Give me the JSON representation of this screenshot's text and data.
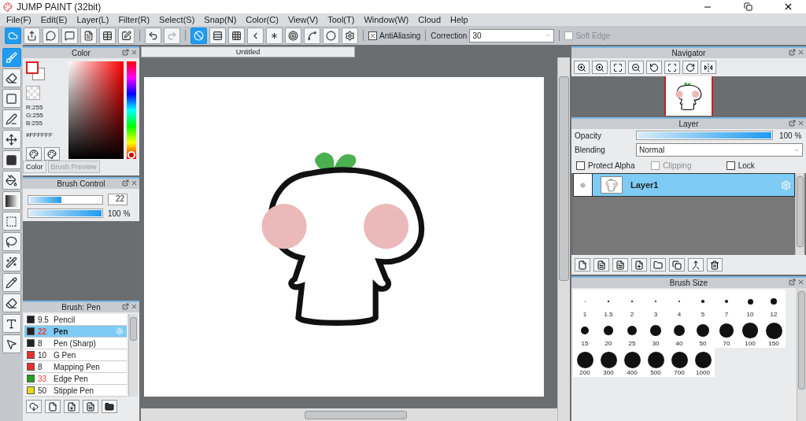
{
  "window": {
    "title": "JUMP PAINT (32bit)"
  },
  "menu": [
    "File(F)",
    "Edit(E)",
    "Layer(L)",
    "Filter(R)",
    "Select(S)",
    "Snap(N)",
    "Color(C)",
    "View(V)",
    "Tool(T)",
    "Window(W)",
    "Cloud",
    "Help"
  ],
  "toolbar": {
    "file_tools": [
      {
        "kind": "cloud",
        "selected": true
      },
      {
        "kind": "share",
        "selected": false
      },
      {
        "kind": "bubble",
        "selected": false
      },
      {
        "kind": "comment",
        "selected": false
      },
      {
        "kind": "page",
        "selected": false
      },
      {
        "kind": "table",
        "selected": false
      },
      {
        "kind": "edit",
        "selected": false
      }
    ],
    "history": [
      {
        "kind": "undo",
        "disabled": false
      },
      {
        "kind": "redo",
        "disabled": true
      }
    ],
    "snap_tools": [
      {
        "kind": "none",
        "selected": true
      },
      {
        "kind": "parallel",
        "selected": false
      },
      {
        "kind": "grid",
        "selected": false
      },
      {
        "kind": "perspective",
        "selected": false
      },
      {
        "kind": "radial",
        "selected": false
      },
      {
        "kind": "concentric",
        "selected": false
      },
      {
        "kind": "curve",
        "selected": false
      },
      {
        "kind": "ellipse",
        "selected": false
      },
      {
        "kind": "settings",
        "selected": false
      }
    ],
    "antialiasing": {
      "label": "AntiAliasing",
      "checked": true
    },
    "correction": {
      "label": "Correction",
      "value": "30"
    },
    "soft_edge": {
      "label": "Soft Edge",
      "checked": false,
      "disabled": true
    }
  },
  "tools": [
    {
      "kind": "brush",
      "selected": true
    },
    {
      "kind": "eraser",
      "selected": false
    },
    {
      "kind": "square",
      "selected": false
    },
    {
      "kind": "vector",
      "selected": false
    },
    {
      "kind": "move",
      "selected": false
    },
    {
      "kind": "fill",
      "selected": false
    },
    {
      "kind": "bucket",
      "selected": false
    },
    {
      "kind": "gradient",
      "selected": false
    },
    {
      "kind": "rect_select",
      "selected": false
    },
    {
      "kind": "lasso",
      "selected": false
    },
    {
      "kind": "wand",
      "selected": false
    },
    {
      "kind": "select_pen",
      "selected": false
    },
    {
      "kind": "select_eraser",
      "selected": false
    },
    {
      "kind": "text",
      "selected": false
    },
    {
      "kind": "pointer",
      "selected": false
    }
  ],
  "color_panel": {
    "title": "Color",
    "r": "R:255",
    "g": "G:255",
    "b": "B:255",
    "hex": "#FFFFFF",
    "tabs": [
      {
        "label": "Color",
        "selected": true
      },
      {
        "label": "Brush Preview",
        "selected": false
      }
    ]
  },
  "brush_control": {
    "title": "Brush Control",
    "size": {
      "level": 0.45,
      "value": "22"
    },
    "opacity": {
      "level": 1,
      "reading": "100 %"
    }
  },
  "brush_list": {
    "title": "Brush: Pen",
    "items": [
      {
        "color": "#222222",
        "size": "9.5",
        "size_changed": false,
        "name": "Pencil",
        "selected": false
      },
      {
        "color": "#222222",
        "size": "22",
        "size_changed": true,
        "name": "Pen",
        "selected": true
      },
      {
        "color": "#222222",
        "size": "8",
        "size_changed": false,
        "name": "Pen (Sharp)",
        "selected": false
      },
      {
        "color": "#e8302c",
        "size": "10",
        "size_changed": false,
        "name": "G Pen",
        "selected": false
      },
      {
        "color": "#e8302c",
        "size": "8",
        "size_changed": false,
        "name": "Mapping Pen",
        "selected": false
      },
      {
        "color": "#1fa31f",
        "size": "33",
        "size_changed": true,
        "name": "Edge Pen",
        "selected": false
      },
      {
        "color": "#e8d81a",
        "size": "50",
        "size_changed": false,
        "name": "Stipple Pen",
        "selected": false
      }
    ]
  },
  "document": {
    "tab": "Untitled"
  },
  "navigator": {
    "title": "Navigator"
  },
  "layer_panel": {
    "title": "Layer",
    "opacity": {
      "label": "Opacity",
      "level": 1,
      "reading": "100 %"
    },
    "blending": {
      "label": "Blending",
      "value": "Normal"
    },
    "options": [
      {
        "label": "Protect Alpha",
        "checked": false,
        "disabled": false
      },
      {
        "label": "Clipping",
        "checked": false,
        "disabled": true
      },
      {
        "label": "Lock",
        "checked": false,
        "disabled": false
      }
    ],
    "layers": [
      {
        "name": "Layer1",
        "selected": true
      }
    ]
  },
  "brush_size": {
    "title": "Brush Size",
    "sizes": [
      "1",
      "1.5",
      "2",
      "3",
      "4",
      "5",
      "7",
      "10",
      "12",
      "15",
      "20",
      "25",
      "30",
      "40",
      "50",
      "70",
      "100",
      "150",
      "200",
      "300",
      "400",
      "500",
      "700",
      "1000"
    ]
  }
}
